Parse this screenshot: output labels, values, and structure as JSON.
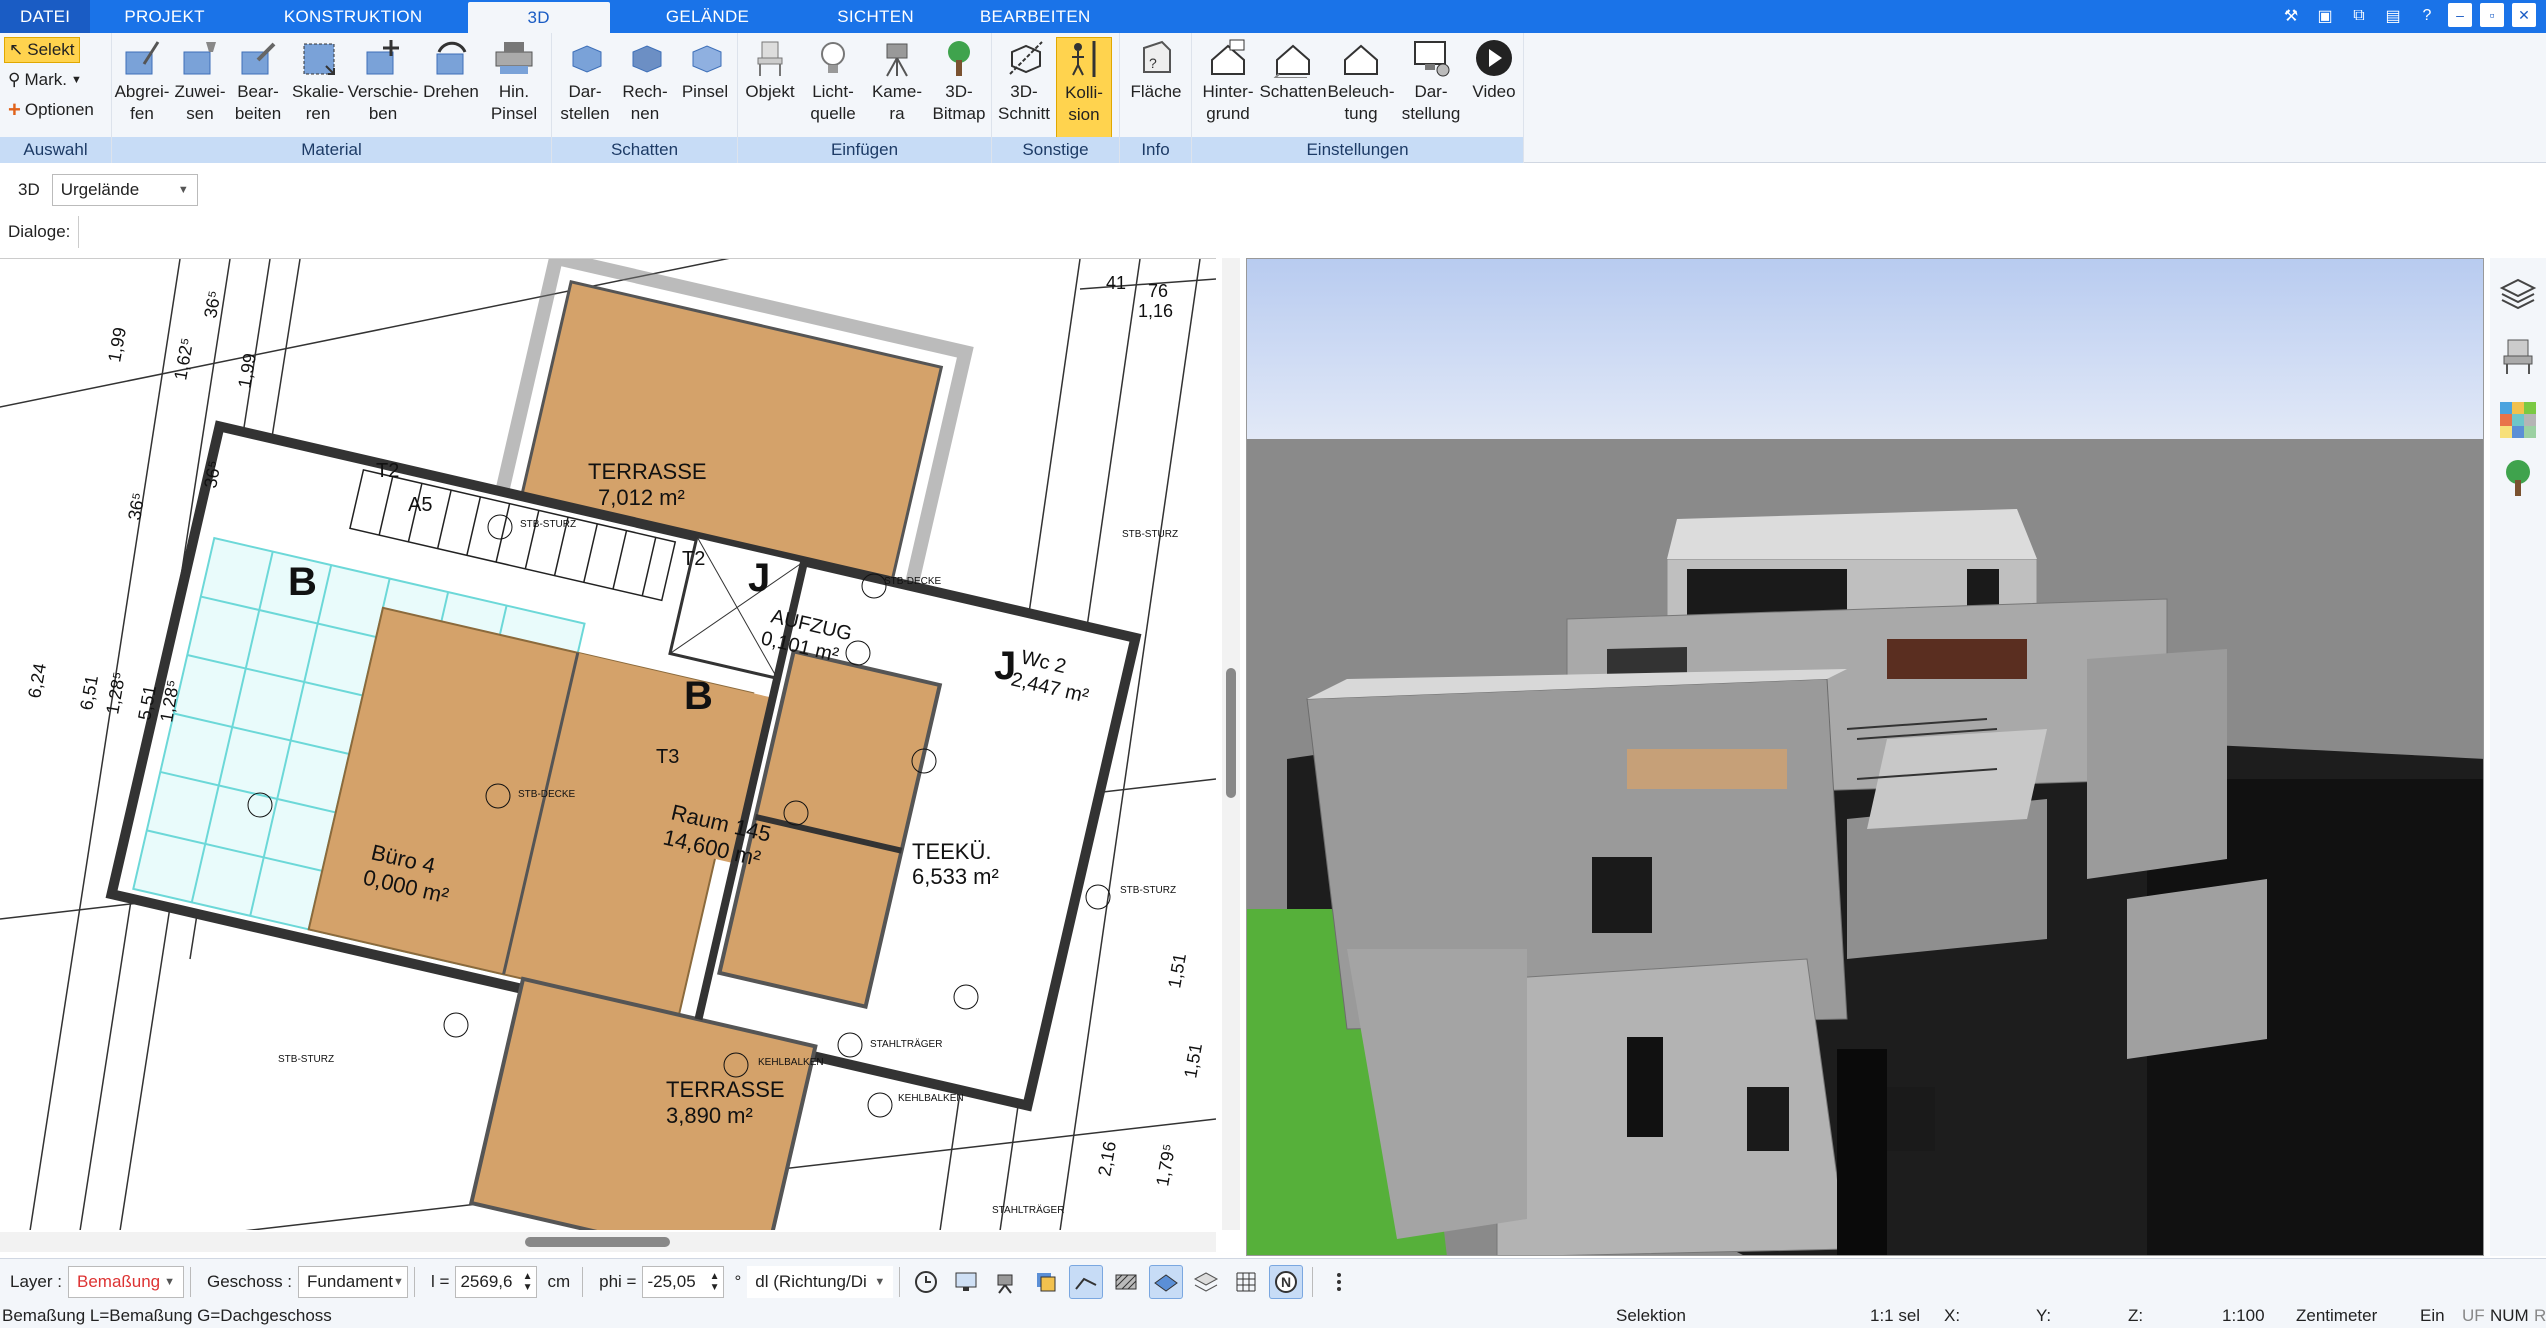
{
  "menu": {
    "file": "DATEI",
    "tabs": [
      "PROJEKT",
      "KONSTRUKTION",
      "3D",
      "GELÄNDE",
      "SICHTEN",
      "BEARBEITEN"
    ],
    "active": "3D"
  },
  "ribbon": {
    "auswahl": {
      "label": "Auswahl",
      "selekt": "Selekt",
      "mark": "Mark.",
      "optionen": "Optionen"
    },
    "material": {
      "label": "Material",
      "buttons": [
        "Abgrei-\nfen",
        "Zuwei-\nsen",
        "Bear-\nbeiten",
        "Skalie-\nren",
        "Verschie-\nben",
        "Drehen",
        "Hin.\nPinsel"
      ]
    },
    "schatten": {
      "label": "Schatten",
      "buttons": [
        "Dar-\nstellen",
        "Rech-\nnen",
        "Pinsel"
      ]
    },
    "einfuegen": {
      "label": "Einfügen",
      "buttons": [
        "Objekt",
        "Licht-\nquelle",
        "Kame-\nra",
        "3D-\nBitmap"
      ]
    },
    "sonstige": {
      "label": "Sonstige",
      "buttons": [
        "3D-\nSchnitt",
        "Kolli-\nsion"
      ]
    },
    "info": {
      "label": "Info",
      "buttons": [
        "Fläche"
      ]
    },
    "einstellungen": {
      "label": "Einstellungen",
      "buttons": [
        "Hinter-\ngrund",
        "Schatten",
        "Beleuch-\ntung",
        "Dar-\nstellung",
        "Video"
      ]
    }
  },
  "toolbar": {
    "mode": "3D",
    "terrain_select": "Urgelände",
    "dialoge_label": "Dialoge:"
  },
  "plan": {
    "rooms": [
      {
        "name": "TERRASSE",
        "area": "7,012 m²"
      },
      {
        "name": "AUFZUG",
        "area": "0,101 m²"
      },
      {
        "name": "Wc 2",
        "area": "2,447 m²"
      },
      {
        "name": "Büro 4",
        "area": "0,000 m²"
      },
      {
        "name": "Raum 145",
        "area": "14,600 m²"
      },
      {
        "name": "TEEKÜ.",
        "area": "6,533 m²"
      },
      {
        "name": "TERRASSE",
        "area": "3,890 m²"
      }
    ],
    "labels": {
      "stb_sturz": "STB-STURZ",
      "stb_decke": "STB-DECKE",
      "kehlbalken": "KEHLBALKEN",
      "stahltraeger": "STAHLTRÄGER",
      "t2": "T2",
      "t3": "T3",
      "a5": "A5",
      "dims": [
        "1,99",
        "1,62⁵",
        "1,99",
        "36⁵",
        "36⁵",
        "36⁵",
        "6,24",
        "6,51",
        "5,51",
        "1,28⁵",
        "1,28⁵",
        "1,51",
        "1,51",
        "2,16",
        "1,79⁵",
        "41",
        "76",
        "1,16"
      ]
    }
  },
  "bottom": {
    "layer_label": "Layer :",
    "layer_value": "Bemaßung",
    "geschoss_label": "Geschoss :",
    "geschoss_value": "Fundament",
    "l_label": "l =",
    "l_value": "2569,6",
    "l_unit": "cm",
    "phi_label": "phi =",
    "phi_value": "-25,05",
    "phi_unit": "°",
    "dl_value": "dl (Richtung/Di"
  },
  "status": {
    "left": "Bemaßung L=Bemaßung G=Dachgeschoss",
    "selektion": "Selektion",
    "sel": "1:1 sel",
    "x": "X:",
    "y": "Y:",
    "z": "Z:",
    "scale": "1:100",
    "unit": "Zentimeter",
    "ein": "Ein",
    "uf": "UF",
    "num": "NUM",
    "r": "R"
  },
  "colors": {
    "accent": "#1a73e8",
    "ribbon_group_label": "#c7dcf6",
    "selected": "#ffd34e",
    "floor_wood": "#d4a26a",
    "sky": "#c7d6f2",
    "grass": "#56b03a"
  }
}
